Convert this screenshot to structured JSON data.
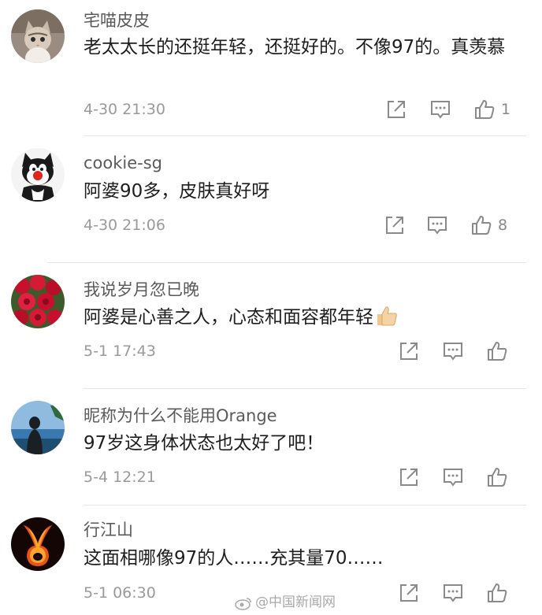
{
  "comments": [
    {
      "username": "宅喵皮皮",
      "text": "老太太长的还挺年轻，还挺好的。不像97的。真羡慕",
      "time": "4-30 21:30",
      "likes": "1",
      "avatar_icon": "kitten-avatar"
    },
    {
      "username": "cookie-sg",
      "text": "阿婆90多，皮肤真好呀",
      "time": "4-30 21:06",
      "likes": "8",
      "avatar_icon": "cartoon-cat-avatar"
    },
    {
      "username": "我说岁月忽已晚",
      "text": "阿婆是心善之人，心态和面容都年轻",
      "time": "5-1 17:43",
      "likes": "",
      "avatar_icon": "red-roses-avatar"
    },
    {
      "username": "昵称为什么不能用Orange",
      "text": "97岁这身体状态也太好了吧！",
      "time": "5-4 12:21",
      "likes": "",
      "avatar_icon": "seaside-silhouette-avatar"
    },
    {
      "username": "行江山",
      "text": "这面相哪像97的人……充其量70……",
      "time": "5-1 06:30",
      "likes": "",
      "avatar_icon": "fire-letter-avatar"
    }
  ],
  "watermark": "@中国新闻网",
  "colors": {
    "username": "#5a5a5a",
    "text": "#1e1e1e",
    "meta": "#9a9a9a",
    "icon": "#8a8a8a",
    "divider": "#e6e6e6"
  }
}
